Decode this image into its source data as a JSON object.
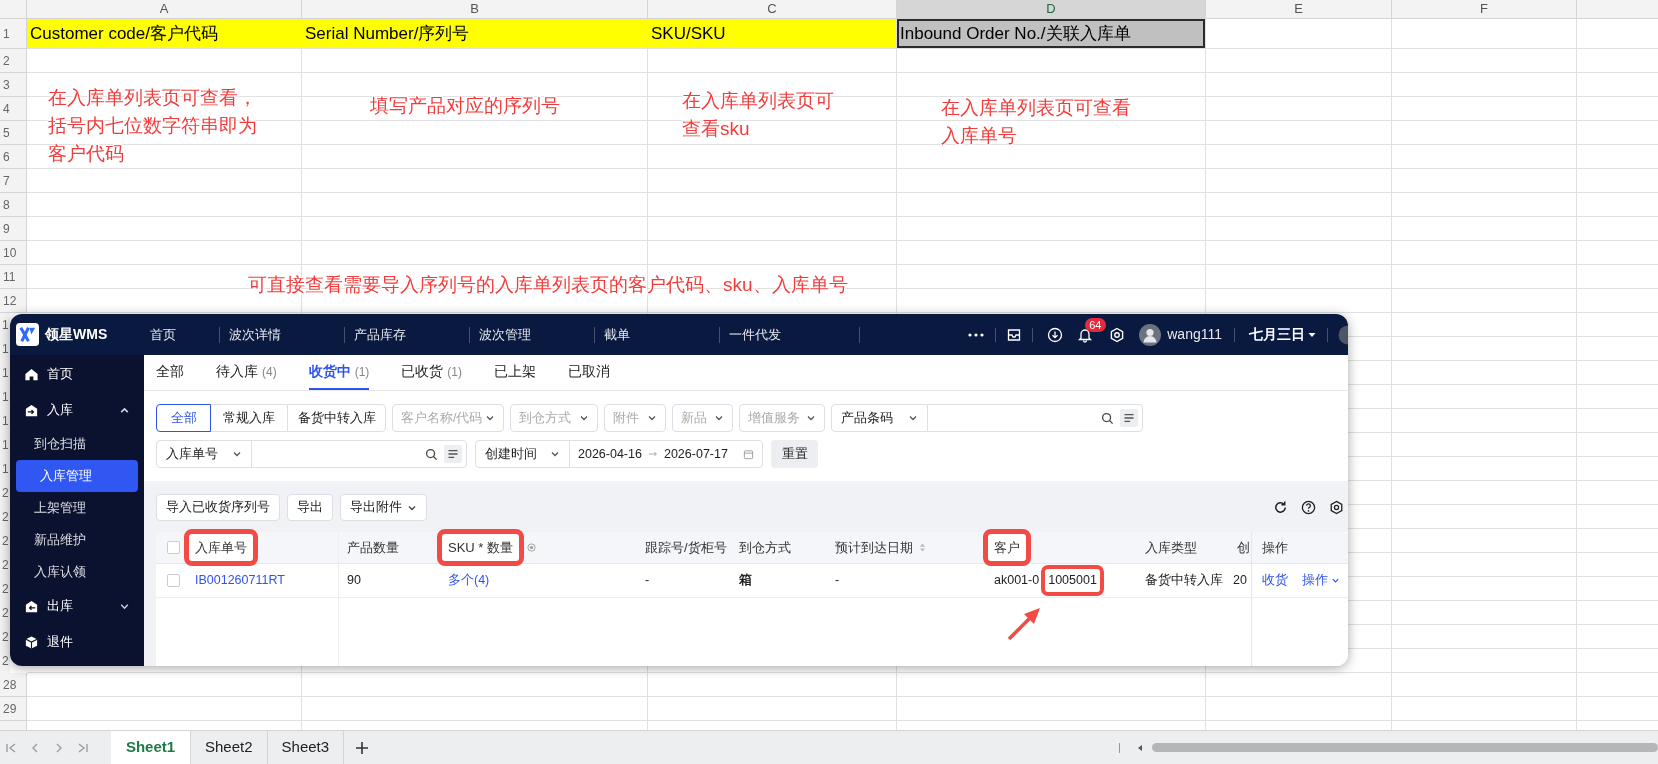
{
  "sheet": {
    "columns": [
      {
        "label": "A",
        "selected": false
      },
      {
        "label": "B",
        "selected": false
      },
      {
        "label": "C",
        "selected": false
      },
      {
        "label": "D",
        "selected": true
      },
      {
        "label": "E",
        "selected": false
      },
      {
        "label": "F",
        "selected": false
      }
    ],
    "rows": [
      {
        "label": "1",
        "cells": [
          {
            "text": "Customer code/客户代码",
            "color": "#ffff00",
            "selected": false
          },
          {
            "text": "Serial Number/序列号",
            "color": "#ffff00",
            "selected": false
          },
          {
            "text": "SKU/SKU",
            "color": "#ffff00",
            "selected": false
          },
          {
            "text": "Inbound Order No./关联入库单",
            "color": "#c0c0c0",
            "selected": true
          }
        ]
      },
      {
        "label": "2"
      },
      {
        "label": "3"
      },
      {
        "label": "4"
      },
      {
        "label": "5"
      },
      {
        "label": "6"
      },
      {
        "label": "7"
      },
      {
        "label": "8"
      },
      {
        "label": "9"
      },
      {
        "label": "10"
      },
      {
        "label": "11"
      },
      {
        "label": "12"
      },
      {
        "label": "1"
      },
      {
        "label": "1"
      },
      {
        "label": "1"
      },
      {
        "label": "1"
      },
      {
        "label": "1"
      },
      {
        "label": "1"
      },
      {
        "label": "1"
      },
      {
        "label": "2"
      },
      {
        "label": "2"
      },
      {
        "label": "2"
      },
      {
        "label": "2"
      },
      {
        "label": "2"
      },
      {
        "label": "2"
      },
      {
        "label": "2"
      },
      {
        "label": "2"
      },
      {
        "label": "28"
      },
      {
        "label": "29"
      }
    ],
    "tabs": [
      {
        "label": "Sheet1",
        "selected": true
      },
      {
        "label": "Sheet2",
        "selected": false
      },
      {
        "label": "Sheet3",
        "selected": false
      }
    ]
  },
  "annotations": [
    {
      "text": "在入库单列表页可查看，括号内七位数字符串即为客户代码"
    },
    {
      "text": "填写产品对应的序列号"
    },
    {
      "text": "在入库单列表页可查看sku"
    },
    {
      "text": "在入库单列表页可查看入库单号"
    },
    {
      "text": "可直接查看需要导入序列号的入库单列表页的客户代码、sku、入库单号"
    }
  ],
  "wms": {
    "brand": "领星WMS",
    "nav": [
      "首页",
      "波次详情",
      "产品库存",
      "波次管理",
      "截单",
      "一件代发"
    ],
    "notification_count": "64",
    "user": "wang111",
    "date_menu": "七月三日",
    "sidebar": [
      {
        "label": "首页",
        "kind": "link"
      },
      {
        "label": "入库",
        "kind": "group",
        "expanded": true,
        "children": [
          {
            "label": "到仓扫描",
            "selected": false
          },
          {
            "label": "入库管理",
            "selected": true
          },
          {
            "label": "上架管理",
            "selected": false
          },
          {
            "label": "新品维护",
            "selected": false
          },
          {
            "label": "入库认领",
            "selected": false
          }
        ]
      },
      {
        "label": "出库",
        "kind": "group",
        "expanded": false
      },
      {
        "label": "退件",
        "kind": "link"
      }
    ],
    "tabs": [
      {
        "label": "全部",
        "selected": false
      },
      {
        "label": "待入库",
        "count": "(4)",
        "selected": false
      },
      {
        "label": "收货中",
        "count": "(1)",
        "selected": true
      },
      {
        "label": "已收货",
        "count": "(1)",
        "selected": false
      },
      {
        "label": "已上架",
        "selected": false
      },
      {
        "label": "已取消",
        "selected": false
      }
    ],
    "filters": {
      "segments": [
        {
          "label": "全部",
          "selected": true
        },
        {
          "label": "常规入库",
          "selected": false
        },
        {
          "label": "备货中转入库",
          "selected": false
        }
      ],
      "dropdowns": [
        {
          "placeholder": "客户名称/代码"
        },
        {
          "placeholder": "到仓方式"
        },
        {
          "placeholder": "附件"
        },
        {
          "placeholder": "新品"
        },
        {
          "placeholder": "增值服务"
        }
      ],
      "barcode_select": "产品条码",
      "order_select": "入库单号",
      "date_select": "创建时间",
      "date_start": "2026-04-16",
      "date_end": "2026-07-17",
      "reset": "重置"
    },
    "toolbar": [
      {
        "label": "导入已收货序列号",
        "kind": "button"
      },
      {
        "label": "导出",
        "kind": "button"
      },
      {
        "label": "导出附件",
        "kind": "dropdown"
      }
    ],
    "table": {
      "select_all_checked": false,
      "columns": [
        {
          "label": "入库单号",
          "kind": "text",
          "highlighted": true
        },
        {
          "label": "产品数量",
          "kind": "text",
          "highlighted": false
        },
        {
          "label": "SKU * 数量",
          "kind": "hint",
          "highlighted": true
        },
        {
          "label": "跟踪号/货柜号",
          "kind": "text",
          "highlighted": false
        },
        {
          "label": "到仓方式",
          "kind": "text",
          "highlighted": false
        },
        {
          "label": "预计到达日期",
          "kind": "sort",
          "highlighted": false
        },
        {
          "label": "客户",
          "kind": "text",
          "highlighted": true
        },
        {
          "label": "入库类型",
          "kind": "text",
          "highlighted": false
        },
        {
          "label": "创",
          "kind": "text",
          "highlighted": false
        },
        {
          "label": "操作",
          "kind": "text",
          "highlighted": false
        }
      ],
      "rows": [
        {
          "checked": false,
          "cells": [
            {
              "kind": "link",
              "text": "IB001260711RT"
            },
            {
              "kind": "plain",
              "text": "90"
            },
            {
              "kind": "link",
              "text": "多个(4)"
            },
            {
              "kind": "plain",
              "text": "-"
            },
            {
              "kind": "bold",
              "text": "箱"
            },
            {
              "kind": "plain",
              "text": "-"
            },
            {
              "kind": "customer",
              "text": "ak001-0",
              "code": "1005001",
              "code_highlighted": true
            },
            {
              "kind": "plain",
              "text": "备货中转入库"
            },
            {
              "kind": "plain",
              "text": "20"
            }
          ],
          "actions": [
            {
              "label": "收货",
              "kind": "link"
            },
            {
              "label": "操作",
              "kind": "dropdown"
            }
          ]
        }
      ]
    }
  }
}
